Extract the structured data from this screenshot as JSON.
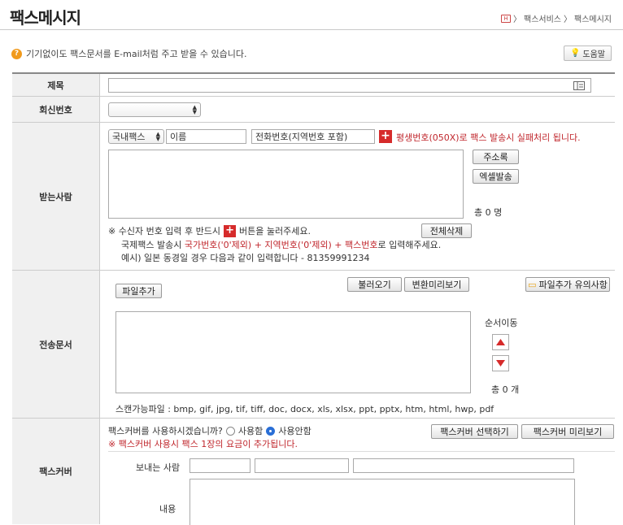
{
  "header": {
    "title": "팩스메시지",
    "breadcrumb": [
      "팩스서비스",
      "팩스메시지"
    ],
    "home_icon": "home-icon"
  },
  "notice": {
    "text": "기기없이도 팩스문서를 E-mail처럼 주고 받을 수 있습니다.",
    "help_label": "도움말"
  },
  "subject": {
    "label": "제목",
    "value": ""
  },
  "reply": {
    "label": "회신번호",
    "selected": ""
  },
  "recipient": {
    "label": "받는사람",
    "fax_type": "국내팩스",
    "name_placeholder": "이름",
    "phone_placeholder": "전화번호(지역번호 포함)",
    "warning": "평생번호(050X)로 팩스 발송시 실패처리 됩니다.",
    "address_book": "주소록",
    "excel_send": "엑셀발송",
    "count_text": "총 0 명",
    "note1_pre": "※ 수신자 번호 입력 후 반드시",
    "note1_post": "버튼을 눌러주세요.",
    "delete_all": "전체삭제",
    "note2_pre": "국제팩스 발송시",
    "note2_red": "국가번호('0'제외) + 지역번호('0'제외) + 팩스번호",
    "note2_post": "로 입력해주세요.",
    "note3": "예시) 일본 동경일 경우 다음과 같이 입력합니다 - 81359991234"
  },
  "documents": {
    "label": "전송문서",
    "add_file": "파일추가",
    "load": "불러오기",
    "preview": "변환미리보기",
    "file_notice": "파일추가 유의사항",
    "order_move": "순서이동",
    "count_text": "총 0 개",
    "scan_types": "스캔가능파일 : bmp, gif, jpg, tif, tiff, doc, docx, xls, xlsx, ppt, pptx, htm, html, hwp, pdf"
  },
  "cover": {
    "label": "팩스커버",
    "question": "팩스커버를 사용하시겠습니까?",
    "use": "사용함",
    "not_use": "사용안함",
    "selected": "사용안함",
    "warning": "※ 팩스커버 사용시 팩스 1장의 요금이 추가됩니다.",
    "select_btn": "팩스커버 선택하기",
    "preview_btn": "팩스커버 미리보기",
    "sender_label": "보내는 사람",
    "content_label": "내용"
  },
  "colors": {
    "accent_red": "#c0272d",
    "notice_orange": "#f19a1c",
    "radio_blue": "#2a6fd6"
  }
}
